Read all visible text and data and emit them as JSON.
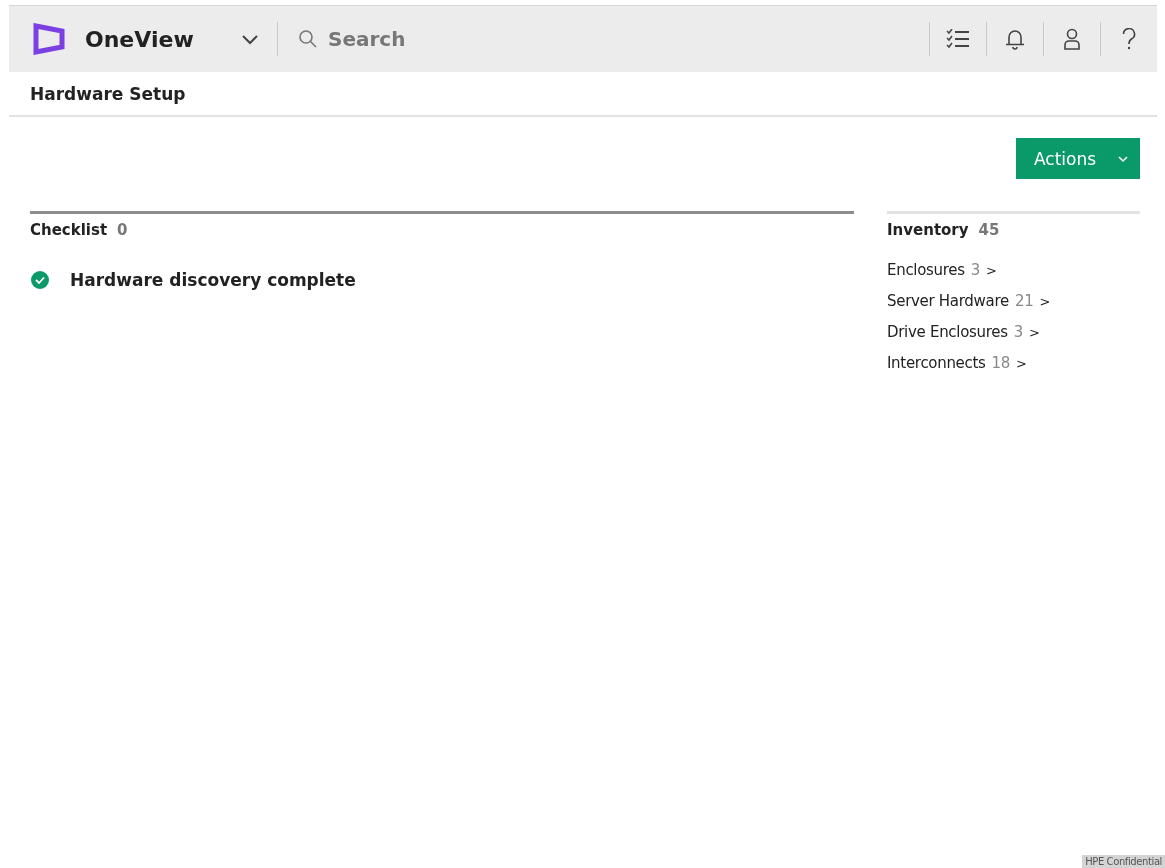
{
  "header": {
    "product": "OneView",
    "search": {
      "placeholder": "Search"
    }
  },
  "page_title": "Hardware Setup",
  "actions_button": "Actions",
  "checklist": {
    "title": "Checklist",
    "count": "0",
    "items": [
      {
        "label": "Hardware discovery complete",
        "complete": true
      }
    ]
  },
  "inventory": {
    "title": "Inventory",
    "count": "45",
    "items": [
      {
        "name": "Enclosures",
        "count": "3",
        "arrow": ">"
      },
      {
        "name": "Server Hardware",
        "count": "21",
        "arrow": ">"
      },
      {
        "name": "Drive Enclosures",
        "count": "3",
        "arrow": ">"
      },
      {
        "name": "Interconnects",
        "count": "18",
        "arrow": ">"
      }
    ]
  },
  "footer_label": "HPE Confidential"
}
